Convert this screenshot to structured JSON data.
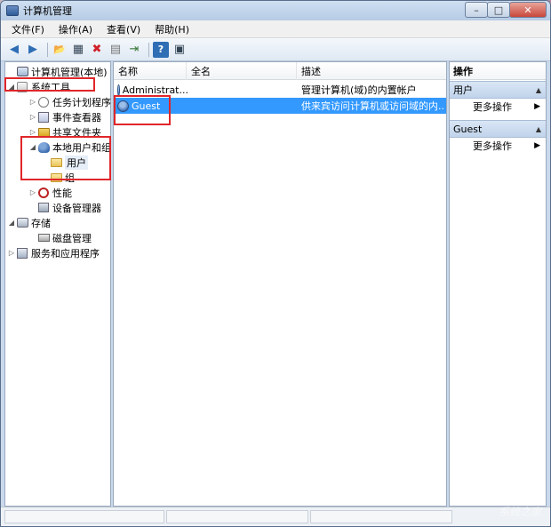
{
  "window": {
    "title": "计算机管理",
    "controls": {
      "minimize": "–",
      "maximize": "□",
      "close": "✕"
    }
  },
  "menu": [
    "文件(F)",
    "操作(A)",
    "查看(V)",
    "帮助(H)"
  ],
  "toolbar": {
    "back": "◀",
    "forward": "▶",
    "up": "📂",
    "show_tree": "▦",
    "delete": "✖",
    "properties": "▤",
    "export": "⇥",
    "help": "?",
    "view": "▣"
  },
  "tree": {
    "root": "计算机管理(本地)",
    "system_tools": "系统工具",
    "task_scheduler": "任务计划程序",
    "event_viewer": "事件查看器",
    "shared_folders": "共享文件夹",
    "local_users_groups": "本地用户和组",
    "users": "用户",
    "groups": "组",
    "performance": "性能",
    "device_manager": "设备管理器",
    "storage": "存储",
    "disk_management": "磁盘管理",
    "services_apps": "服务和应用程序"
  },
  "list": {
    "columns": {
      "name": "名称",
      "fullname": "全名",
      "description": "描述"
    },
    "rows": [
      {
        "name": "Administrat...",
        "fullname": "",
        "description": "管理计算机(域)的内置帐户",
        "selected": false
      },
      {
        "name": "Guest",
        "fullname": "",
        "description": "供来宾访问计算机或访问域的内...",
        "selected": true
      }
    ]
  },
  "actions": {
    "title": "操作",
    "section1": {
      "title": "用户",
      "item": "更多操作"
    },
    "section2": {
      "title": "Guest",
      "item": "更多操作"
    }
  },
  "watermark": "系统之家",
  "highlight_color": "#e0262a",
  "selection_color": "#3399ff"
}
